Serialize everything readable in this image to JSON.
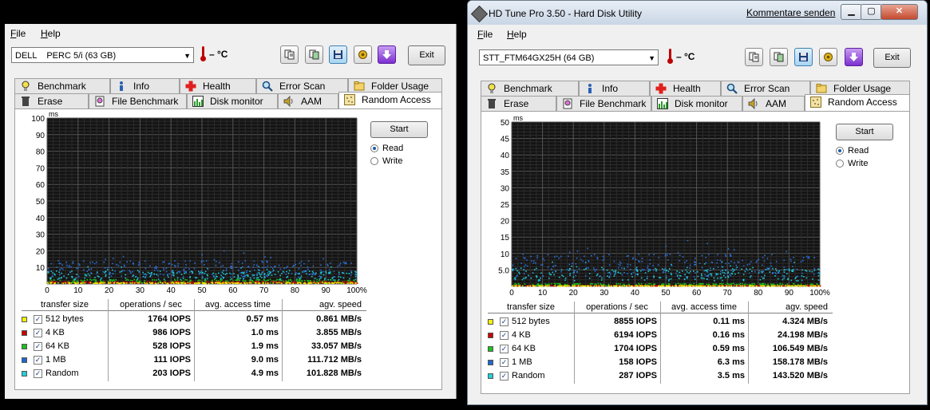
{
  "left_window": {
    "menu": [
      "File",
      "Help"
    ],
    "drive": "DELL    PERC 5/i (63 GB)",
    "temp": "– °C",
    "exit_label": "Exit",
    "tabs_row1": [
      "Benchmark",
      "Info",
      "Health",
      "Error Scan",
      "Folder Usage"
    ],
    "tabs_row2": [
      "Erase",
      "File Benchmark",
      "Disk monitor",
      "AAM",
      "Random Access"
    ],
    "start_label": "Start",
    "read_label": "Read",
    "write_label": "Write",
    "chart_data": {
      "type": "scatter",
      "ylabel": "ms",
      "yticks": [
        "100",
        "90",
        "80",
        "70",
        "60",
        "50",
        "40",
        "30",
        "20",
        "10"
      ],
      "xticks": [
        "0",
        "10",
        "20",
        "30",
        "40",
        "50",
        "60",
        "70",
        "80",
        "90",
        "100%"
      ],
      "ylim": [
        0,
        100
      ],
      "xlim": [
        0,
        100
      ],
      "series": [
        {
          "name": "512 bytes",
          "color": "#e8e800",
          "level_ms": 0.57
        },
        {
          "name": "4 KB",
          "color": "#d40000",
          "level_ms": 1.0
        },
        {
          "name": "64 KB",
          "color": "#19c119",
          "level_ms": 1.9
        },
        {
          "name": "1 MB",
          "color": "#2a6fd6",
          "level_ms": 9.0
        },
        {
          "name": "Random",
          "color": "#1ec8d8",
          "level_ms": 4.9
        }
      ]
    },
    "table": {
      "headers": [
        "transfer size",
        "operations / sec",
        "avg. access time",
        "agv. speed"
      ],
      "rows": [
        {
          "color": "#f4f400",
          "label": "512 bytes",
          "ops": "1764 IOPS",
          "access": "0.57 ms",
          "speed": "0.861 MB/s"
        },
        {
          "color": "#c80000",
          "label": "4 KB",
          "ops": "986 IOPS",
          "access": "1.0 ms",
          "speed": "3.855 MB/s"
        },
        {
          "color": "#1fbf1f",
          "label": "64 KB",
          "ops": "528 IOPS",
          "access": "1.9 ms",
          "speed": "33.057 MB/s"
        },
        {
          "color": "#2266cc",
          "label": "1 MB",
          "ops": "111 IOPS",
          "access": "9.0 ms",
          "speed": "111.712 MB/s"
        },
        {
          "color": "#22d0d8",
          "label": "Random",
          "ops": "203 IOPS",
          "access": "4.9 ms",
          "speed": "101.828 MB/s"
        }
      ]
    }
  },
  "right_window": {
    "title": "HD Tune Pro 3.50 - Hard Disk Utility",
    "link": "Kommentare senden",
    "menu": [
      "File",
      "Help"
    ],
    "drive": "STT_FTM64GX25H (64 GB)",
    "temp": "– °C",
    "exit_label": "Exit",
    "tabs_row1": [
      "Benchmark",
      "Info",
      "Health",
      "Error Scan",
      "Folder Usage"
    ],
    "tabs_row2": [
      "Erase",
      "File Benchmark",
      "Disk monitor",
      "AAM",
      "Random Access"
    ],
    "start_label": "Start",
    "read_label": "Read",
    "write_label": "Write",
    "chart_data": {
      "type": "scatter",
      "ylabel": "ms",
      "yticks": [
        "50",
        "45",
        "40",
        "35",
        "30",
        "25",
        "20",
        "15",
        "10",
        "5.0"
      ],
      "xticks": [
        "0",
        "10",
        "20",
        "30",
        "40",
        "50",
        "60",
        "70",
        "80",
        "90",
        "100%"
      ],
      "ylim": [
        0,
        50
      ],
      "xlim": [
        0,
        100
      ],
      "series": [
        {
          "name": "512 bytes",
          "color": "#e8e800",
          "level_ms": 0.11
        },
        {
          "name": "4 KB",
          "color": "#d40000",
          "level_ms": 0.16
        },
        {
          "name": "64 KB",
          "color": "#19c119",
          "level_ms": 0.59
        },
        {
          "name": "1 MB",
          "color": "#2a6fd6",
          "level_ms": 6.3
        },
        {
          "name": "Random",
          "color": "#1ec8d8",
          "level_ms": 3.5
        }
      ]
    },
    "table": {
      "headers": [
        "transfer size",
        "operations / sec",
        "avg. access time",
        "agv. speed"
      ],
      "rows": [
        {
          "color": "#f4f400",
          "label": "512 bytes",
          "ops": "8855 IOPS",
          "access": "0.11 ms",
          "speed": "4.324 MB/s"
        },
        {
          "color": "#c80000",
          "label": "4 KB",
          "ops": "6194 IOPS",
          "access": "0.16 ms",
          "speed": "24.198 MB/s"
        },
        {
          "color": "#1fbf1f",
          "label": "64 KB",
          "ops": "1704 IOPS",
          "access": "0.59 ms",
          "speed": "106.549 MB/s"
        },
        {
          "color": "#2266cc",
          "label": "1 MB",
          "ops": "158 IOPS",
          "access": "6.3 ms",
          "speed": "158.178 MB/s"
        },
        {
          "color": "#22d0d8",
          "label": "Random",
          "ops": "287 IOPS",
          "access": "3.5 ms",
          "speed": "143.520 MB/s"
        }
      ]
    }
  }
}
